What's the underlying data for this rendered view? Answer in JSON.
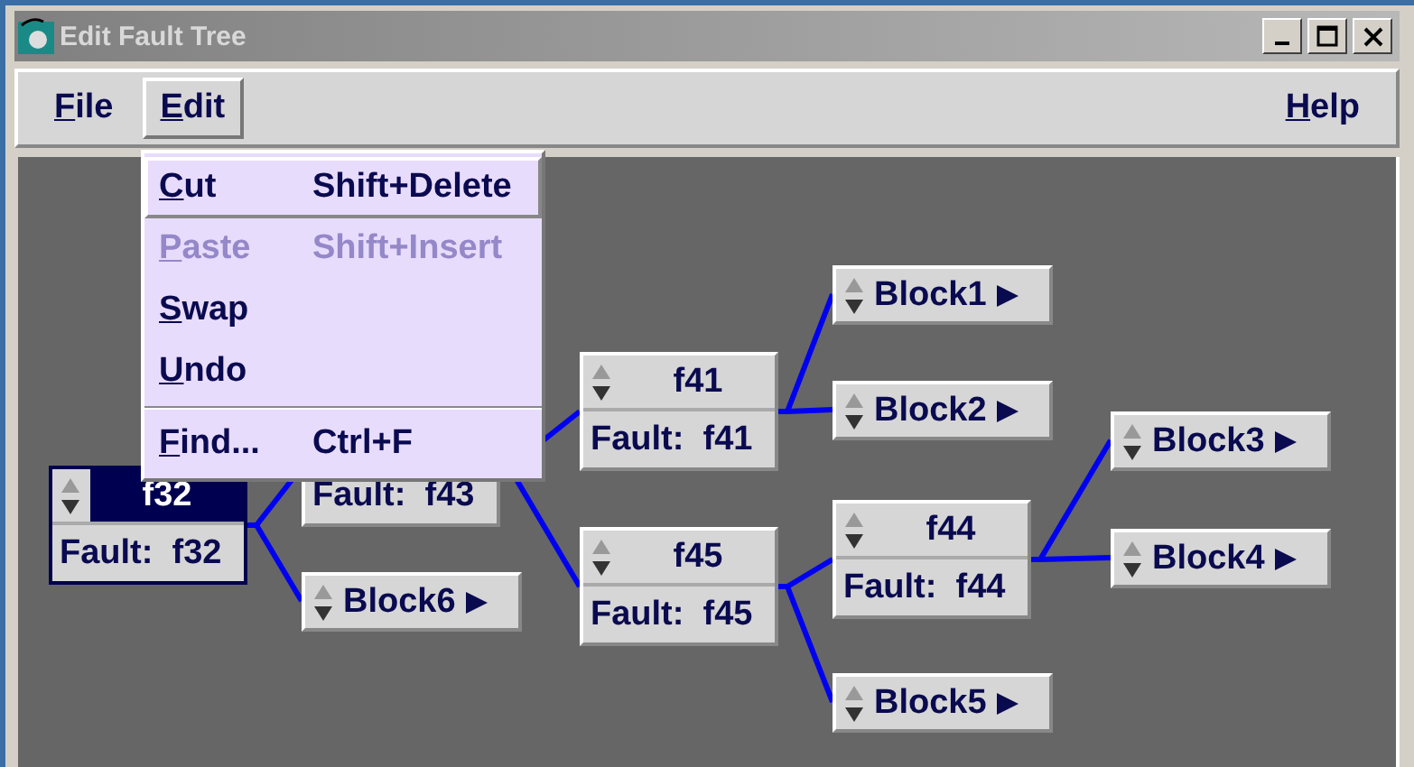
{
  "window": {
    "title": "Edit Fault Tree"
  },
  "menubar": [
    {
      "label": "File",
      "selected": false
    },
    {
      "label": "Edit",
      "selected": true
    },
    {
      "label": "Help",
      "selected": false
    }
  ],
  "edit_menu": [
    {
      "kind": "command",
      "label": "Cut",
      "shortcut": "Shift+Delete",
      "selected": true,
      "disabled": false
    },
    {
      "kind": "command",
      "label": "Paste",
      "shortcut": "Shift+Insert",
      "selected": false,
      "disabled": true
    },
    {
      "kind": "command",
      "label": "Swap",
      "selected": false,
      "disabled": false
    },
    {
      "kind": "command",
      "label": "Undo",
      "selected": false,
      "disabled": false
    },
    {
      "kind": "separator"
    },
    {
      "kind": "command",
      "label": "Find...",
      "shortcut": "Ctrl+F",
      "selected": false,
      "disabled": false
    }
  ],
  "tree": {
    "kind": "fault",
    "title": "f32",
    "label": "Fault:  f32",
    "selected": true,
    "children": [
      {
        "kind": "fault",
        "label": "Fault:  f43",
        "selected": false,
        "children": [
          {
            "kind": "fault",
            "title": "f41",
            "label": "Fault:  f41",
            "selected": false,
            "children": [
              {
                "kind": "block",
                "title": "Block1",
                "selected": false
              },
              {
                "kind": "block",
                "title": "Block2",
                "selected": false
              }
            ]
          },
          {
            "kind": "fault",
            "title": "f45",
            "label": "Fault:  f45",
            "selected": false,
            "children": [
              {
                "kind": "fault",
                "title": "f44",
                "label": "Fault:  f44",
                "selected": false,
                "children": [
                  {
                    "kind": "block",
                    "title": "Block3",
                    "selected": false
                  },
                  {
                    "kind": "block",
                    "title": "Block4",
                    "selected": false
                  }
                ]
              },
              {
                "kind": "block",
                "title": "Block5",
                "selected": false
              }
            ]
          }
        ]
      },
      {
        "kind": "block",
        "title": "Block6",
        "selected": false
      }
    ]
  }
}
